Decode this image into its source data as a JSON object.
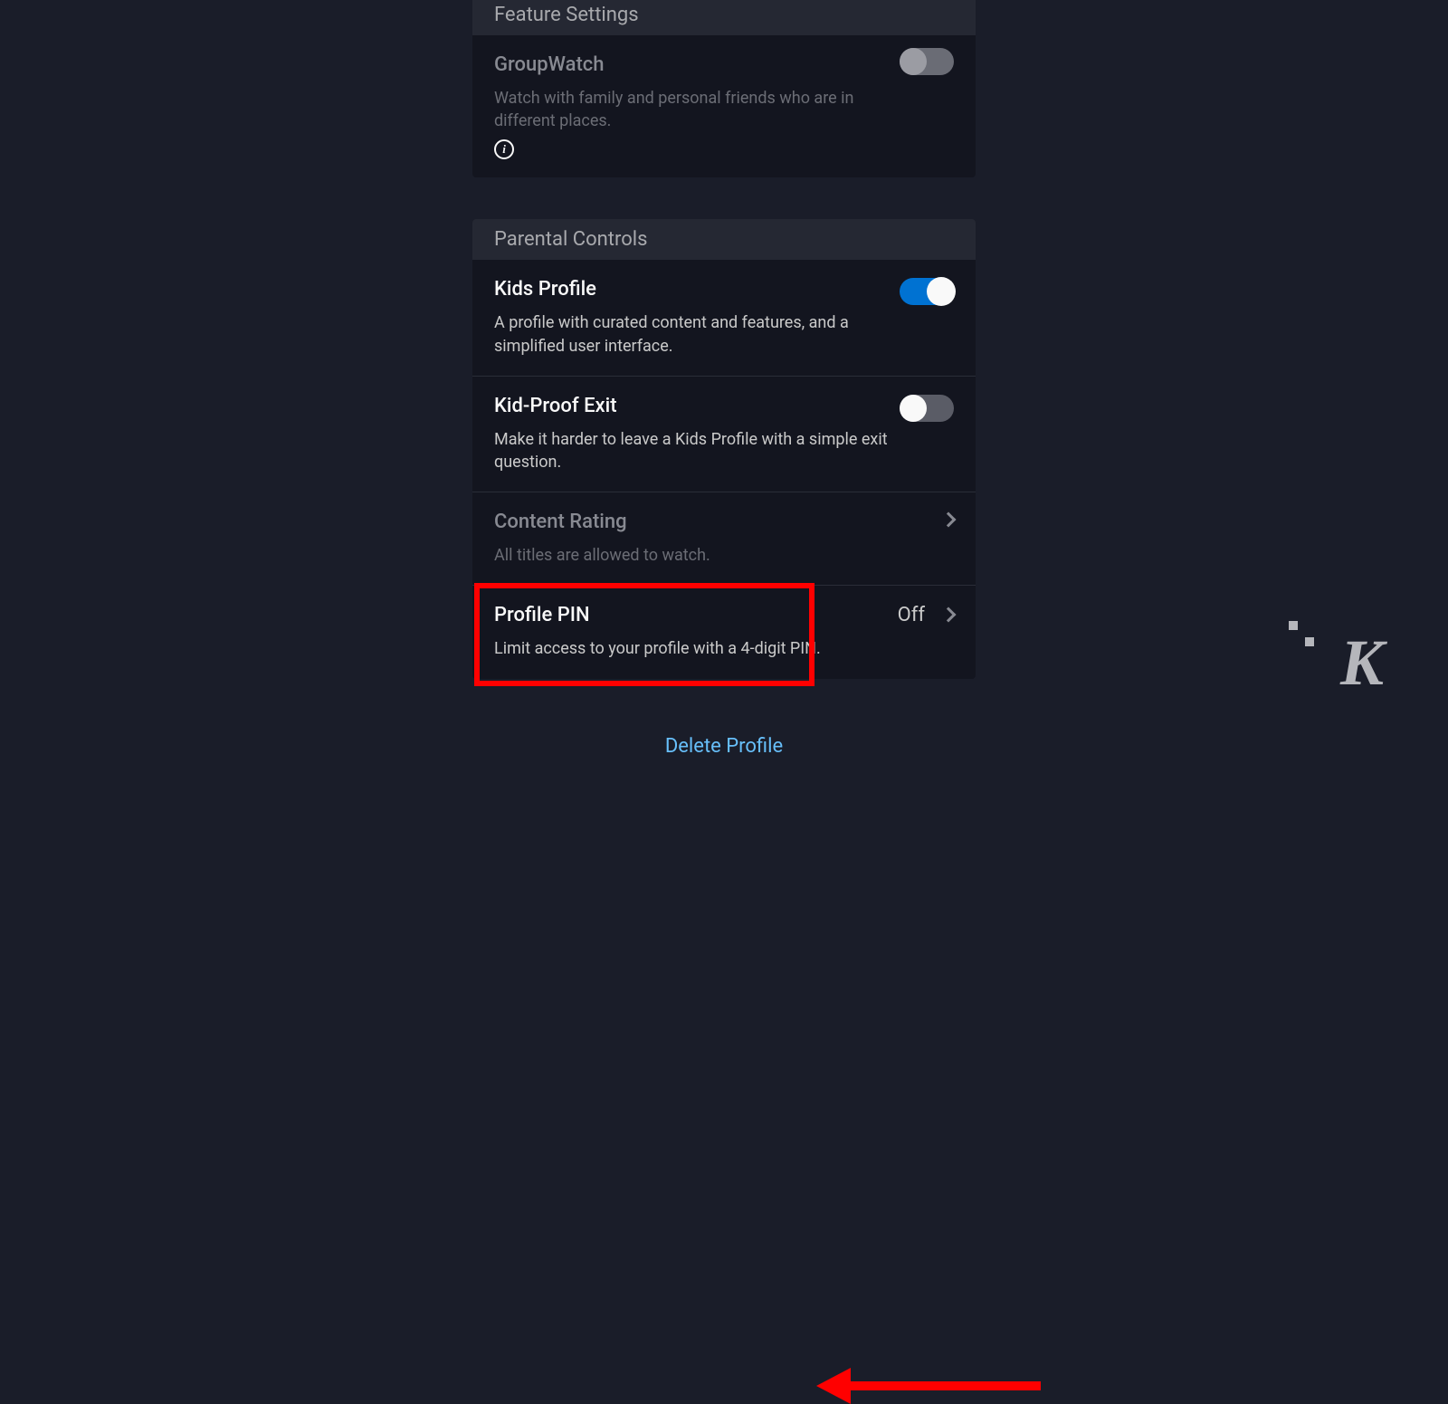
{
  "sections": {
    "feature": {
      "header": "Feature Settings",
      "groupwatch": {
        "title": "GroupWatch",
        "description": "Watch with family and personal friends who are in different places."
      }
    },
    "parental": {
      "header": "Parental Controls",
      "kids_profile": {
        "title": "Kids Profile",
        "description": "A profile with curated content and features, and a simplified user interface."
      },
      "kid_proof_exit": {
        "title": "Kid-Proof Exit",
        "description": "Make it harder to leave a Kids Profile with a simple exit question."
      },
      "content_rating": {
        "title": "Content Rating",
        "description": "All titles are allowed to watch."
      },
      "profile_pin": {
        "title": "Profile PIN",
        "description": "Limit access to your profile with a 4-digit PIN.",
        "value": "Off"
      }
    }
  },
  "delete_link": "Delete Profile",
  "watermark": "K"
}
